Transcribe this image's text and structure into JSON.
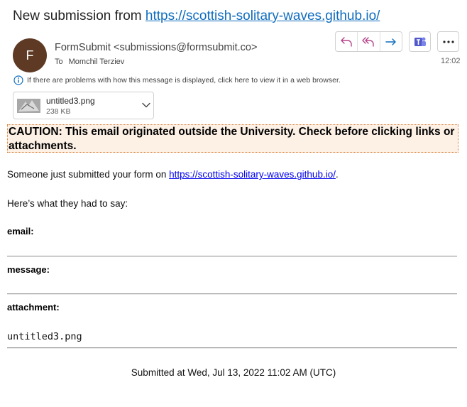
{
  "header": {
    "subject_prefix": "New submission from ",
    "subject_link": "https://scottish-solitary-waves.github.io/",
    "avatar_initial": "F",
    "sender": "FormSubmit <submissions@formsubmit.co>",
    "to_label": "To",
    "recipient": "Momchil Terziev",
    "time": "12:02",
    "info_text": "If there are problems with how this message is displayed, click here to view it in a web browser.",
    "actions": [
      "reply-icon",
      "reply-all-icon",
      "forward-icon",
      "teams-icon",
      "more-icon"
    ]
  },
  "attachment": {
    "filename": "untitled3.png",
    "size": "238 KB"
  },
  "body": {
    "caution": "CAUTION: This email originated outside the University. Check before clicking links or attachments.",
    "intro_prefix": "Someone just submitted your form on ",
    "intro_link": "https://scottish-solitary-waves.github.io/",
    "intro_suffix": ".",
    "lead": "Here’s what they had to say:",
    "fields": [
      {
        "label": "email:",
        "value": ""
      },
      {
        "label": "message:",
        "value": ""
      },
      {
        "label": "attachment:",
        "value": "untitled3.png"
      }
    ],
    "submitted": "Submitted at Wed, Jul 13, 2022 11:02 AM (UTC)"
  },
  "colors": {
    "accent": "#0f6cbd",
    "avatar": "#5e3a24",
    "caution_bg": "#fdf1e6",
    "caution_border": "#d87c33",
    "teams": "#5059c9"
  }
}
